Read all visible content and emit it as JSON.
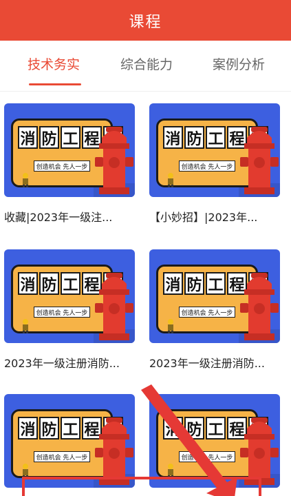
{
  "header": {
    "title": "课程"
  },
  "tabs": [
    {
      "label": "技术务实",
      "active": true
    },
    {
      "label": "综合能力",
      "active": false
    },
    {
      "label": "案例分析",
      "active": false
    }
  ],
  "thumbnail": {
    "chars": [
      "消",
      "防",
      "工",
      "程",
      "师"
    ],
    "subtitle": "创造机会 先人一步"
  },
  "courses": [
    {
      "title": "收藏|2023年一级注..."
    },
    {
      "title": "【小妙招】|2023年..."
    },
    {
      "title": "2023年一级注册消防..."
    },
    {
      "title": "2023年一级注册消防..."
    },
    {
      "title": ""
    },
    {
      "title": ""
    }
  ],
  "colors": {
    "accent": "#e94a35",
    "thumb_bg": "#3d5fe0",
    "banner": "#f6b347",
    "hydrant": "#e23b2f",
    "annotation": "#e53935"
  }
}
